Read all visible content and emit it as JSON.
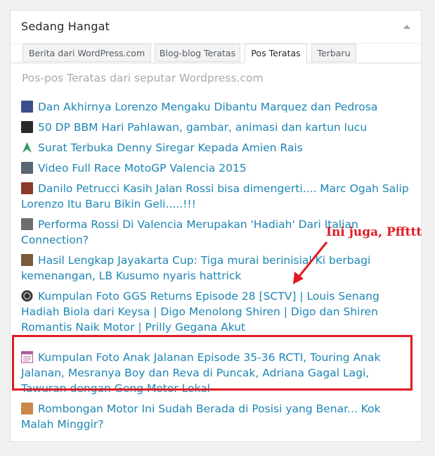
{
  "widget": {
    "title": "Sedang Hangat",
    "toggle_icon": "triangle-up-icon"
  },
  "tabs": [
    {
      "label": "Berita dari WordPress.com",
      "active": false
    },
    {
      "label": "Blog-blog Teratas",
      "active": false
    },
    {
      "label": "Pos Teratas",
      "active": true
    },
    {
      "label": "Terbaru",
      "active": false
    }
  ],
  "subtitle": "Pos-pos Teratas dari seputar Wordpress.com",
  "posts": [
    {
      "title": "Dan Akhirnya Lorenzo Mengaku Dibantu Marquez dan Pedrosa",
      "thumb_color": "#3a4f8a",
      "thumb_icon": "motogp-thumbnail-icon"
    },
    {
      "title": "50 DP BBM Hari Pahlawan, gambar, animasi dan kartun lucu",
      "thumb_color": "#2b2b2b",
      "thumb_icon": "cartoon-thumbnail-icon"
    },
    {
      "title": "Surat Terbuka Denny Siregar Kepada Amien Rais",
      "thumb_color": "#2e9e5b",
      "thumb_icon": "arrow-logo-icon"
    },
    {
      "title": "Video Full Race MotoGP Valencia 2015",
      "thumb_color": "#5a6578",
      "thumb_icon": "race-thumbnail-icon"
    },
    {
      "title": "Danilo Petrucci Kasih Jalan Rossi bisa dimengerti.... Marc Ogah Salip Lorenzo Itu Baru Bikin Geli.....!!!",
      "thumb_color": "#8b3a2a",
      "thumb_icon": "rider-thumbnail-icon"
    },
    {
      "title": "Performa Rossi Di Valencia Merupakan 'Hadiah' Dari Italian Connection?",
      "thumb_color": "#6e6e6e",
      "thumb_icon": "track-thumbnail-icon"
    },
    {
      "title": "Hasil Lengkap Jayakarta Cup: Tiga murai berinisial Ki berbagi kemenangan, LB Kusumo nyaris hattrick",
      "thumb_color": "#7a5a3a",
      "thumb_icon": "bird-thumbnail-icon"
    },
    {
      "title": "Kumpulan Foto GGS Returns Episode 28 [SCTV] | Louis Senang Hadiah Biola dari Keysa | Digo Menolong Shiren | Digo dan Shiren Romantis Naik Motor | Prilly Gegana Akut",
      "thumb_color": "#333333",
      "thumb_icon": "circle-logo-icon"
    },
    {
      "title": "Kumpulan Foto Anak Jalanan Episode 35-36 RCTI, Touring Anak Jalanan, Mesranya Boy dan Reva di Puncak, Adriana Gagal Lagi, Tawuran dengan Geng Motor Lokal",
      "thumb_color": "#b05a9c",
      "thumb_icon": "document-thumbnail-icon"
    },
    {
      "title": "Rombongan Motor Ini Sudah Berada di Posisi yang Benar... Kok Malah Minggir?",
      "thumb_color": "#c8884a",
      "thumb_icon": "blog-thumbnail-icon"
    }
  ],
  "annotation": {
    "text": "Ini juga, Pffttt",
    "color": "#e01b24"
  },
  "colors": {
    "link": "#1e86b4",
    "muted": "#a7aaad",
    "highlight": "#e01b24"
  }
}
